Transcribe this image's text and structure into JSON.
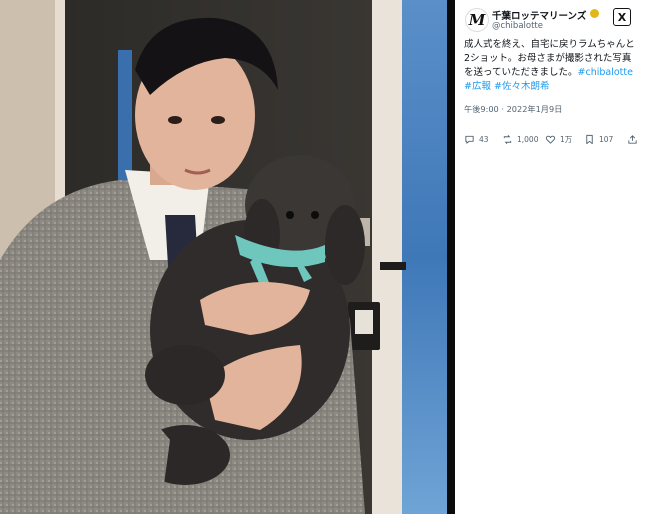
{
  "post": {
    "author": {
      "display_name": "千葉ロッテマリーンズ",
      "handle": "@chibalotte",
      "avatar_letter": "M",
      "verified_color": "#e2b719"
    },
    "text": "成人式を終え、自宅に戻りラムちゃんと2ショット。お母さまが撮影された写真を送っていただきました。",
    "hashtags": [
      "#chibalotte",
      "#広報",
      "#佐々木朗希"
    ],
    "timestamp": "午後9:00 · 2022年1月9日",
    "actions": {
      "replies": "43",
      "reposts": "1,000",
      "likes": "1万",
      "bookmarks": "107"
    },
    "x_logo": "X"
  },
  "colors": {
    "hashtag": "#1d9bf0",
    "secondary_text": "#536471",
    "divider": "#0b0b0b"
  },
  "icons": {
    "reply": "speech-bubble-icon",
    "repost": "repost-arrows-icon",
    "like": "heart-icon",
    "bookmark": "bookmark-icon",
    "share": "upload-share-icon"
  }
}
